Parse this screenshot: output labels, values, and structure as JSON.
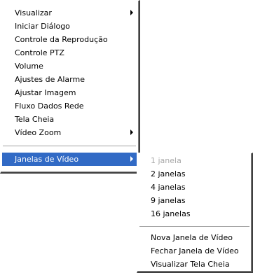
{
  "main_menu": {
    "items": [
      {
        "label": "Visualizar",
        "submenu": true
      },
      {
        "label": "Iniciar Diálogo"
      },
      {
        "label": "Controle da Reprodução"
      },
      {
        "label": "Controle PTZ"
      },
      {
        "label": "Volume"
      },
      {
        "label": "Ajustes de Alarme"
      },
      {
        "label": "Ajustar Imagem"
      },
      {
        "label": "Fluxo Dados Rede"
      },
      {
        "label": "Tela Cheia"
      },
      {
        "label": "Vídeo Zoom",
        "submenu": true
      },
      {
        "label": "Janelas de Vídeo",
        "submenu": true,
        "selected": true
      }
    ]
  },
  "sub_menu": {
    "items": [
      {
        "label": "1 janela",
        "disabled": true
      },
      {
        "label": "2 janelas"
      },
      {
        "label": "4 janelas"
      },
      {
        "label": "9 janelas"
      },
      {
        "label": "16 janelas"
      },
      {
        "label": "Nova Janela de Vídeo"
      },
      {
        "label": "Fechar Janela de Vídeo"
      },
      {
        "label": "Visualizar Tela Cheia"
      }
    ]
  },
  "colors": {
    "highlight": "#316ac5",
    "disabled_text": "#a8a8a8"
  }
}
